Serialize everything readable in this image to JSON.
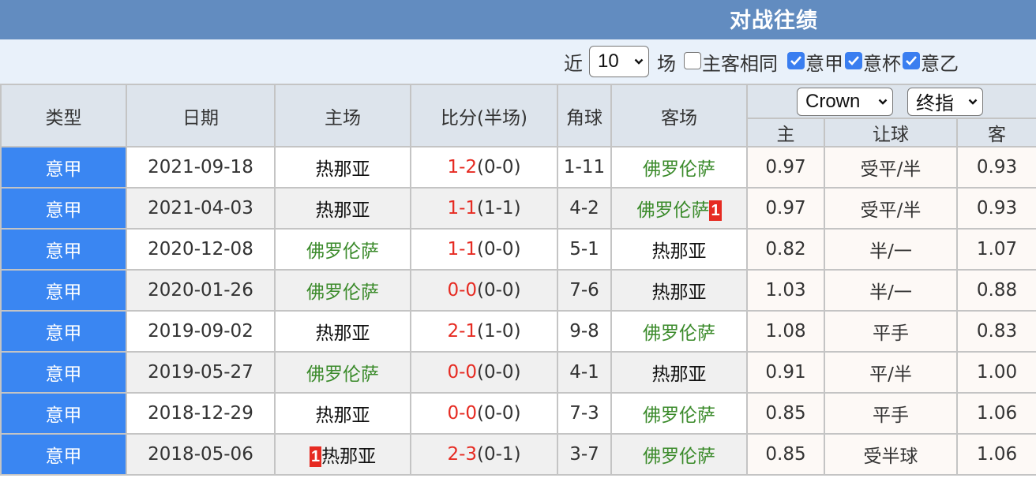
{
  "header": {
    "title": "对战往绩"
  },
  "filters": {
    "recent_prefix": "近",
    "recent_count": "10",
    "recent_suffix": "场",
    "same_home_away": {
      "label": "主客相同",
      "checked": false
    },
    "leagues": [
      {
        "label": "意甲",
        "checked": true
      },
      {
        "label": "意杯",
        "checked": true
      },
      {
        "label": "意乙",
        "checked": true
      }
    ]
  },
  "table": {
    "columns": {
      "type": "类型",
      "date": "日期",
      "home": "主场",
      "score": "比分(半场)",
      "corners": "角球",
      "away": "客场",
      "odds_home": "主",
      "handicap": "让球",
      "odds_away": "客"
    },
    "company_select": "Crown",
    "odds_type_select": "终指",
    "rows": [
      {
        "type": "意甲",
        "date": "2021-09-18",
        "home": "热那亚",
        "home_color": "black",
        "home_badge": "",
        "score": "1-2",
        "half": "(0-0)",
        "corners": "1-11",
        "away": "佛罗伦萨",
        "away_color": "green",
        "away_badge": "",
        "odds_home": "0.97",
        "handicap": "受平/半",
        "odds_away": "0.93"
      },
      {
        "type": "意甲",
        "date": "2021-04-03",
        "home": "热那亚",
        "home_color": "black",
        "home_badge": "",
        "score": "1-1",
        "half": "(1-1)",
        "corners": "4-2",
        "away": "佛罗伦萨",
        "away_color": "green",
        "away_badge": "1",
        "odds_home": "0.97",
        "handicap": "受平/半",
        "odds_away": "0.93"
      },
      {
        "type": "意甲",
        "date": "2020-12-08",
        "home": "佛罗伦萨",
        "home_color": "green",
        "home_badge": "",
        "score": "1-1",
        "half": "(0-0)",
        "corners": "5-1",
        "away": "热那亚",
        "away_color": "black",
        "away_badge": "",
        "odds_home": "0.82",
        "handicap": "半/一",
        "odds_away": "1.07"
      },
      {
        "type": "意甲",
        "date": "2020-01-26",
        "home": "佛罗伦萨",
        "home_color": "green",
        "home_badge": "",
        "score": "0-0",
        "half": "(0-0)",
        "corners": "7-6",
        "away": "热那亚",
        "away_color": "black",
        "away_badge": "",
        "odds_home": "1.03",
        "handicap": "半/一",
        "odds_away": "0.88"
      },
      {
        "type": "意甲",
        "date": "2019-09-02",
        "home": "热那亚",
        "home_color": "black",
        "home_badge": "",
        "score": "2-1",
        "half": "(1-0)",
        "corners": "9-8",
        "away": "佛罗伦萨",
        "away_color": "green",
        "away_badge": "",
        "odds_home": "1.08",
        "handicap": "平手",
        "odds_away": "0.83"
      },
      {
        "type": "意甲",
        "date": "2019-05-27",
        "home": "佛罗伦萨",
        "home_color": "green",
        "home_badge": "",
        "score": "0-0",
        "half": "(0-0)",
        "corners": "4-1",
        "away": "热那亚",
        "away_color": "black",
        "away_badge": "",
        "odds_home": "0.91",
        "handicap": "平/半",
        "odds_away": "1.00"
      },
      {
        "type": "意甲",
        "date": "2018-12-29",
        "home": "热那亚",
        "home_color": "black",
        "home_badge": "",
        "score": "0-0",
        "half": "(0-0)",
        "corners": "7-3",
        "away": "佛罗伦萨",
        "away_color": "green",
        "away_badge": "",
        "odds_home": "0.85",
        "handicap": "平手",
        "odds_away": "1.06"
      },
      {
        "type": "意甲",
        "date": "2018-05-06",
        "home": "热那亚",
        "home_color": "black",
        "home_badge": "1",
        "score": "2-3",
        "half": "(0-1)",
        "corners": "3-7",
        "away": "佛罗伦萨",
        "away_color": "green",
        "away_badge": "",
        "odds_home": "0.85",
        "handicap": "受半球",
        "odds_away": "1.06"
      }
    ]
  }
}
